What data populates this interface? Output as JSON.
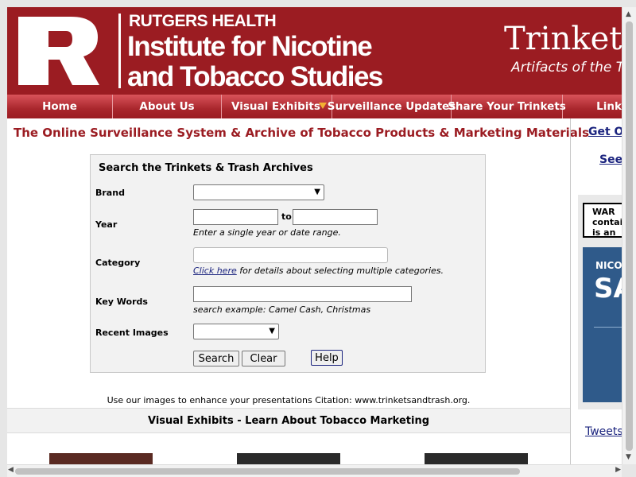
{
  "header": {
    "org_top": "RUTGERS HEALTH",
    "org_line1": "Institute for Nicotine",
    "org_line2": "and Tobacco Studies",
    "site_title": "Trinkets",
    "site_subtitle": "Artifacts of the To"
  },
  "nav": {
    "items": [
      {
        "label": "Home"
      },
      {
        "label": "About Us"
      },
      {
        "label": "Visual Exhibits"
      },
      {
        "label": "Surveillance Updates"
      },
      {
        "label": "Share Your Trinkets"
      },
      {
        "label": "Link"
      }
    ]
  },
  "main": {
    "title": "The Online Surveillance System & Archive of Tobacco Products & Marketing Materials",
    "citation": "Use our images to enhance your presentations Citation: www.trinketsandtrash.org.",
    "visual_exhibits_heading": "Visual Exhibits - Learn About Tobacco Marketing"
  },
  "search": {
    "title": "Search the Trinkets & Trash Archives",
    "brand_label": "Brand",
    "year_label": "Year",
    "year_to": "to",
    "year_hint": "Enter a single year or date range.",
    "category_label": "Category",
    "category_link": "Click here",
    "category_hint": " for details about selecting multiple categories.",
    "keywords_label": "Key Words",
    "keywords_hint": "search example: Camel Cash, Christmas",
    "recent_label": "Recent Images",
    "search_button": "Search",
    "clear_button": "Clear",
    "help_button": "Help"
  },
  "right_column": {
    "link1": "Get Ou",
    "link2": "See",
    "ad_warning": "WAR\ncontai\nis an",
    "ad_brand": "NICO",
    "ad_big": "SAT",
    "tweets": "Tweets"
  }
}
